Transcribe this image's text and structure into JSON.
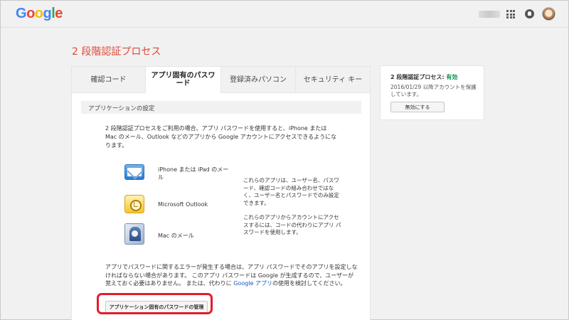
{
  "header": {
    "logo_letters": [
      {
        "ch": "G",
        "color": "#4285f4"
      },
      {
        "ch": "o",
        "color": "#ea4335"
      },
      {
        "ch": "o",
        "color": "#fbbc05"
      },
      {
        "ch": "g",
        "color": "#4285f4"
      },
      {
        "ch": "l",
        "color": "#34a853"
      },
      {
        "ch": "e",
        "color": "#ea4335"
      }
    ],
    "icons": [
      "apps-icon",
      "notifications-icon",
      "avatar"
    ]
  },
  "page": {
    "title": "2 段階認証プロセス"
  },
  "tabs": [
    {
      "label": "確認コード",
      "active": false
    },
    {
      "label": "アプリ固有のパスワード",
      "active": true
    },
    {
      "label": "登録済みパソコン",
      "active": false
    },
    {
      "label": "セキュリティ キー",
      "active": false
    }
  ],
  "section": {
    "header": "アプリケーションの設定",
    "intro": "2 段階認証プロセスをご利用の場合、アプリ パスワードを使用すると、iPhone または Mac のメール、Outlook などのアプリから Google アカウントにアクセスできるようになります。",
    "apps": [
      {
        "label": "iPhone または iPad のメール",
        "icon": "iphone-mail-icon"
      },
      {
        "label": "Microsoft Outlook",
        "icon": "outlook-icon"
      },
      {
        "label": "Mac のメール",
        "icon": "mac-mail-icon"
      }
    ],
    "side_note_1": "これらのアプリは、ユーザー名、パスワード、確認コードの組み合わせではなく、ユーザー名とパスワードでのみ設定できます。",
    "side_note_2": "これらのアプリからアカウントにアクセスするには、コードの代わりにアプリ パスワードを使用します。",
    "error_note_before": "アプリでパスワードに関するエラーが発生する場合は、アプリ パスワードでそのアプリを設定しなければならない場合があります。 このアプリ パスワードは Google が生成するので、ユーザーが覚えておく必要はありません。 または、代わりに ",
    "error_note_link": "Google アプリ",
    "error_note_after": "の使用を検討してください。",
    "manage_button": "アプリケーション固有のパスワードの管理"
  },
  "status_card": {
    "title": "2 段階認証プロセス: ",
    "status": "有効",
    "status_color": "#0d904f",
    "description": "2016/01/29 以降アカウントを保護しています。",
    "disable_button": "無効にする"
  },
  "colors": {
    "title_red": "#dd4b39",
    "highlight_red": "#e21d2b",
    "link_blue": "#1155cc"
  }
}
